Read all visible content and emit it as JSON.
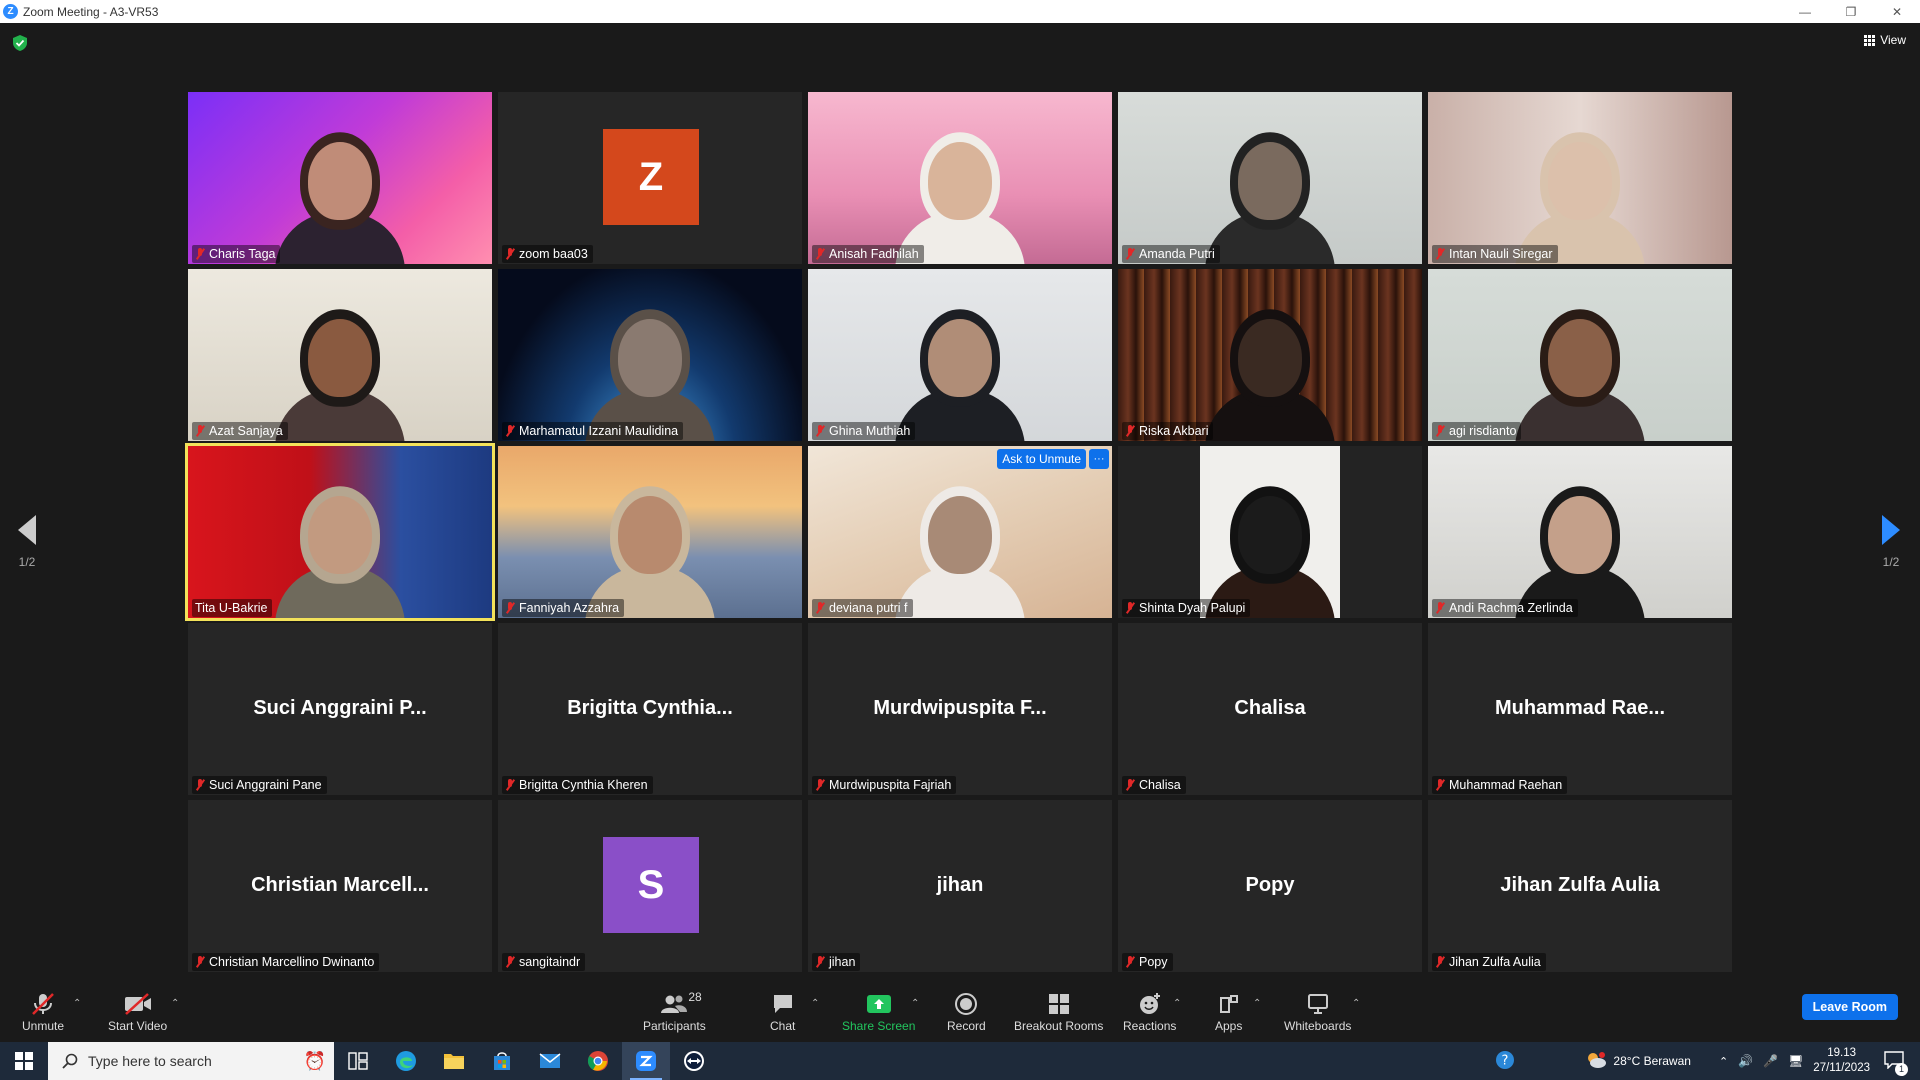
{
  "window": {
    "title": "Zoom Meeting - A3-VR53",
    "logo_letter": "Z"
  },
  "view_button": {
    "label": "View"
  },
  "pager": {
    "left": "1/2",
    "right": "1/2"
  },
  "tiles": [
    {
      "name": "Charis Taga",
      "kind": "video",
      "bg": "linear-gradient(135deg,#7b2ff7 0%,#c03bd8 45%,#f45ea8 75%,#ff8fb0 100%)",
      "skin": "#c08c78",
      "hair": "#3a2420",
      "shirt": "#2c2230"
    },
    {
      "name": "zoom baa03",
      "kind": "avatar",
      "letter": "Z",
      "color": "#d4481c"
    },
    {
      "name": "Anisah Fadhilah",
      "kind": "video",
      "bg": "linear-gradient(180deg,#f7b8cf 0%,#e98fb4 60%,#c46b94 100%)",
      "skin": "#d9b49a",
      "hair": "#f0ede8",
      "shirt": "#f0ede8"
    },
    {
      "name": "Amanda Putri",
      "kind": "video",
      "bg": "linear-gradient(180deg,#d8dcd9 0%,#c5cac8 100%)",
      "skin": "#7a6a5e",
      "hair": "#222222",
      "shirt": "#2a2a2a"
    },
    {
      "name": "Intan Nauli Siregar",
      "kind": "video",
      "bg": "linear-gradient(90deg,#c9b0a8 0%,#e6d8d2 50%,#b89890 100%)",
      "skin": "#dcc0ab",
      "hair": "#d9c3ad",
      "shirt": "#d9c3ad"
    },
    {
      "name": "Azat Sanjaya",
      "kind": "video",
      "bg": "linear-gradient(180deg,#ede9df 0%,#d8d2c5 100%)",
      "skin": "#8a5a40",
      "hair": "#1e1a18",
      "shirt": "#4a3a38"
    },
    {
      "name": "Marhamatul Izzani Maulidina",
      "kind": "video",
      "bg": "radial-gradient(ellipse at 50% 110%,#4aa3e8 0%,#123a6e 40%,#050b1c 75%)",
      "skin": "#8a7a70",
      "hair": "#5a5048",
      "shirt": "#5a5048"
    },
    {
      "name": "Ghina Muthiah",
      "kind": "video",
      "bg": "linear-gradient(180deg,#e6e8ea 0%,#d4d7da 100%)",
      "skin": "#b08d77",
      "hair": "#1d1f24",
      "shirt": "#1d1f24"
    },
    {
      "name": "Riska Akbari",
      "kind": "video",
      "bg": "repeating-linear-gradient(90deg,#3a1a10 0px,#6b3420 10px,#2a120a 18px,#8a4a24 26px)",
      "skin": "#3a2a22",
      "hair": "#151010",
      "shirt": "#151010"
    },
    {
      "name": "agi risdianto",
      "kind": "video",
      "bg": "linear-gradient(180deg,#d6dcd8 0%,#c8cfca 100%)",
      "skin": "#8a6048",
      "hair": "#2a1c16",
      "shirt": "#3a3030"
    },
    {
      "name": "Tita U-Bakrie",
      "kind": "video",
      "active": true,
      "bg": "linear-gradient(90deg,#d8151c 0%,#c01018 40%,#2b4fa0 70%,#1d3a80 100%)",
      "skin": "#c29a80",
      "hair": "#b5a690",
      "shirt": "#6f6a5c"
    },
    {
      "name": "Fanniyah Azzahra",
      "kind": "video",
      "bg": "linear-gradient(180deg,#e9a86a 0%,#f2c27e 35%,#7a8fb0 65%,#5c7090 100%)",
      "skin": "#b88a6e",
      "hair": "#c9b79c",
      "shirt": "#c9b79c"
    },
    {
      "name": "deviana putri f",
      "kind": "video",
      "ask": true,
      "bg": "linear-gradient(160deg,#f1e6d8 0%,#e4cdb4 50%,#d6b394 100%)",
      "skin": "#a88a76",
      "hair": "#eeeae6",
      "shirt": "#eeeae6"
    },
    {
      "name": "Shinta Dyah Palupi",
      "kind": "video",
      "bg": "linear-gradient(90deg,#232323 0%,#232323 27%,#f0efec 27%,#f0efec 73%,#232323 73%)",
      "skin": "#1b1b1b",
      "hair": "#121212",
      "shirt": "#2b1a14"
    },
    {
      "name": "Andi Rachma Zerlinda",
      "kind": "video",
      "bg": "linear-gradient(180deg,#e8e8e6 0%,#d0d0cc 100%)",
      "skin": "#c4a08a",
      "hair": "#1a1a1a",
      "shirt": "#1a1a1a"
    },
    {
      "name": "Suci Anggraini Pane",
      "kind": "name",
      "big": "Suci Anggraini P..."
    },
    {
      "name": "Brigitta Cynthia Kheren",
      "kind": "name",
      "big": "Brigitta Cynthia..."
    },
    {
      "name": "Murdwipuspita Fajriah",
      "kind": "name",
      "big": "Murdwipuspita F..."
    },
    {
      "name": "Chalisa",
      "kind": "name",
      "big": "Chalisa"
    },
    {
      "name": "Muhammad Raehan",
      "kind": "name",
      "big": "Muhammad Rae..."
    },
    {
      "name": "Christian Marcellino Dwinanto",
      "kind": "name",
      "big": "Christian Marcell..."
    },
    {
      "name": "sangitaindr",
      "kind": "avatar",
      "letter": "S",
      "color": "#8a4fc8"
    },
    {
      "name": "jihan",
      "kind": "name",
      "big": "jihan"
    },
    {
      "name": "Popy",
      "kind": "name",
      "big": "Popy"
    },
    {
      "name": "Jihan Zulfa Aulia",
      "kind": "name",
      "big": "Jihan Zulfa Aulia"
    }
  ],
  "tile_overlay": {
    "ask_to_unmute": "Ask to Unmute",
    "more": "···"
  },
  "toolbar": {
    "unmute": "Unmute",
    "start_video": "Start Video",
    "participants": "Participants",
    "participants_count": "28",
    "chat": "Chat",
    "share_screen": "Share Screen",
    "record": "Record",
    "breakout_rooms": "Breakout Rooms",
    "reactions": "Reactions",
    "apps": "Apps",
    "whiteboards": "Whiteboards",
    "leave": "Leave Room"
  },
  "taskbar": {
    "search_placeholder": "Type here to search",
    "weather": "28°C  Berawan",
    "time": "19.13",
    "date": "27/11/2023",
    "notification_count": "1"
  },
  "colors": {
    "accent": "#0e71eb",
    "share_green": "#22c55e",
    "active_speaker": "#f3e25a",
    "muted_red": "#e02828"
  },
  "icons": [
    "shield-check-icon",
    "grid-view-icon",
    "mic-muted-icon",
    "video-off-icon",
    "participants-icon",
    "chat-icon",
    "share-screen-icon",
    "record-icon",
    "breakout-rooms-icon",
    "reactions-icon",
    "apps-icon",
    "whiteboard-icon",
    "windows-start-icon",
    "search-icon"
  ]
}
